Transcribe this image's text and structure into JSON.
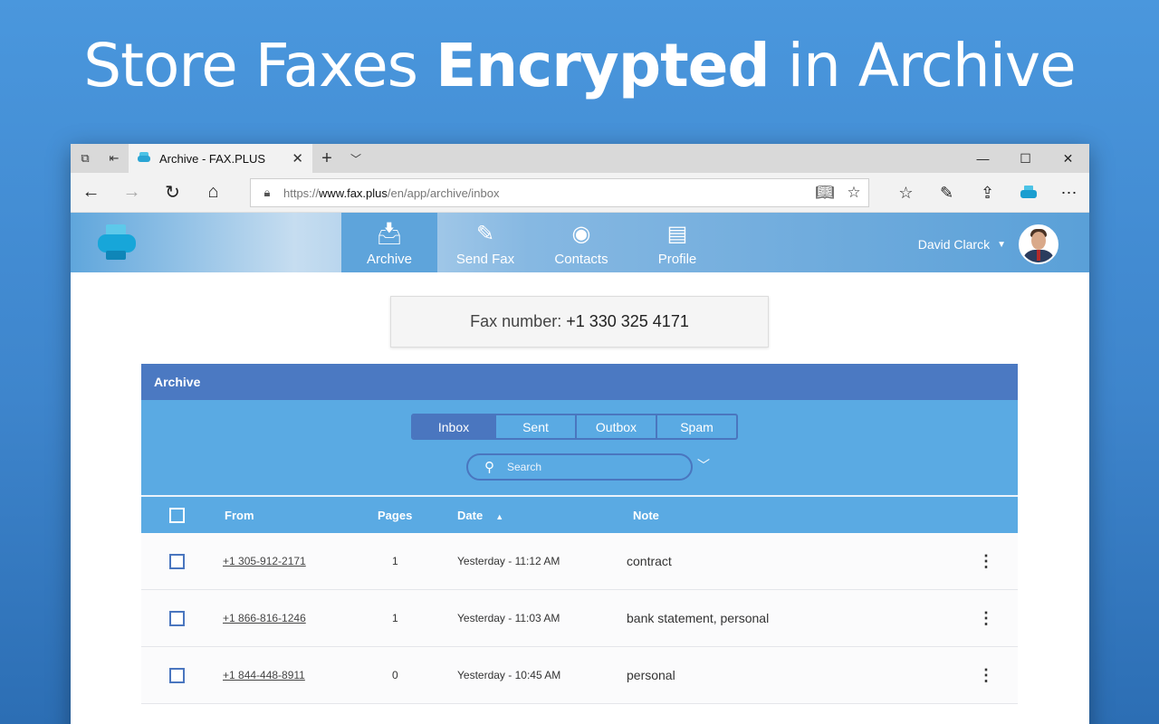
{
  "headline": {
    "normal1": "Store Faxes ",
    "bold": "Encrypted",
    "normal2": " in Archive"
  },
  "browser": {
    "tab_title": "Archive - FAX.PLUS",
    "url_scheme": "https://",
    "url_host": "www.fax.plus",
    "url_path": "/en/app/archive/inbox"
  },
  "app": {
    "nav": [
      {
        "label": "Archive",
        "icon": "inbox-icon"
      },
      {
        "label": "Send Fax",
        "icon": "edit-icon"
      },
      {
        "label": "Contacts",
        "icon": "person-icon"
      },
      {
        "label": "Profile",
        "icon": "id-card-icon"
      }
    ],
    "user_name": "David Clarck"
  },
  "fax_number": {
    "label": "Fax number:",
    "value": "+1 330 325 4171"
  },
  "archive": {
    "title": "Archive",
    "tabs": [
      "Inbox",
      "Sent",
      "Outbox",
      "Spam"
    ],
    "active_tab": "Inbox",
    "search_placeholder": "Search",
    "columns": {
      "from": "From",
      "pages": "Pages",
      "date": "Date",
      "note": "Note"
    },
    "rows": [
      {
        "from": "+1 305-912-2171",
        "pages": "1",
        "date": "Yesterday - 11:12 AM",
        "note": "contract"
      },
      {
        "from": "+1 866-816-1246",
        "pages": "1",
        "date": "Yesterday - 11:03 AM",
        "note": "bank statement, personal"
      },
      {
        "from": "+1 844-448-8911",
        "pages": "0",
        "date": "Yesterday - 10:45 AM",
        "note": "personal"
      }
    ]
  },
  "colors": {
    "accent_dark": "#4b79c2",
    "accent_light": "#5aaae3",
    "background": "#3e85cc"
  }
}
